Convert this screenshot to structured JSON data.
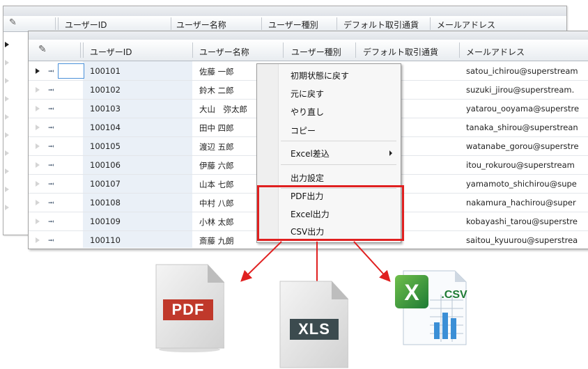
{
  "back_grid": {
    "headers": [
      "ユーザーID",
      "ユーザー名称",
      "ユーザー種別",
      "デフォルト取引通貨",
      "メールアドレス"
    ]
  },
  "front_grid": {
    "headers": [
      "ユーザーID",
      "ユーザー名称",
      "ユーザー種別",
      "デフォルト取引通貨",
      "メールアドレス"
    ],
    "rows": [
      {
        "id": "100101",
        "name": "佐藤 一郎",
        "email": "satou_ichirou@superstream"
      },
      {
        "id": "100102",
        "name": "鈴木 二郎",
        "email": "suzuki_jirou@superstream."
      },
      {
        "id": "100103",
        "name": "大山　弥太郎",
        "email": "yatarou_ooyama@superstre"
      },
      {
        "id": "100104",
        "name": "田中 四郎",
        "email": "tanaka_shirou@superstrean"
      },
      {
        "id": "100105",
        "name": "渡辺 五郎",
        "email": "watanabe_gorou@superstre"
      },
      {
        "id": "100106",
        "name": "伊藤 六郎",
        "email": "itou_rokurou@superstream"
      },
      {
        "id": "100107",
        "name": "山本 七郎",
        "email": "yamamoto_shichirou@supe"
      },
      {
        "id": "100108",
        "name": "中村 八郎",
        "email": "nakamura_hachirou@super"
      },
      {
        "id": "100109",
        "name": "小林 太郎",
        "email": "kobayashi_tarou@superstre"
      },
      {
        "id": "100110",
        "name": "斎藤 九朗",
        "email": "saitou_kyuurou@superstrea"
      }
    ]
  },
  "context_menu": {
    "items": [
      "初期状態に戻す",
      "元に戻す",
      "やり直し",
      "コピー",
      "Excel差込",
      "出力設定",
      "PDF出力",
      "Excel出力",
      "CSV出力"
    ]
  },
  "icons": {
    "pdf_label": "PDF",
    "xls_label": "XLS",
    "csv_label": ".CSV"
  },
  "colors": {
    "highlight": "#e02020",
    "pdf_label_bg": "#c0392b",
    "xls_label_bg": "#3c4b4f",
    "excel_green": "#1e7b34"
  }
}
